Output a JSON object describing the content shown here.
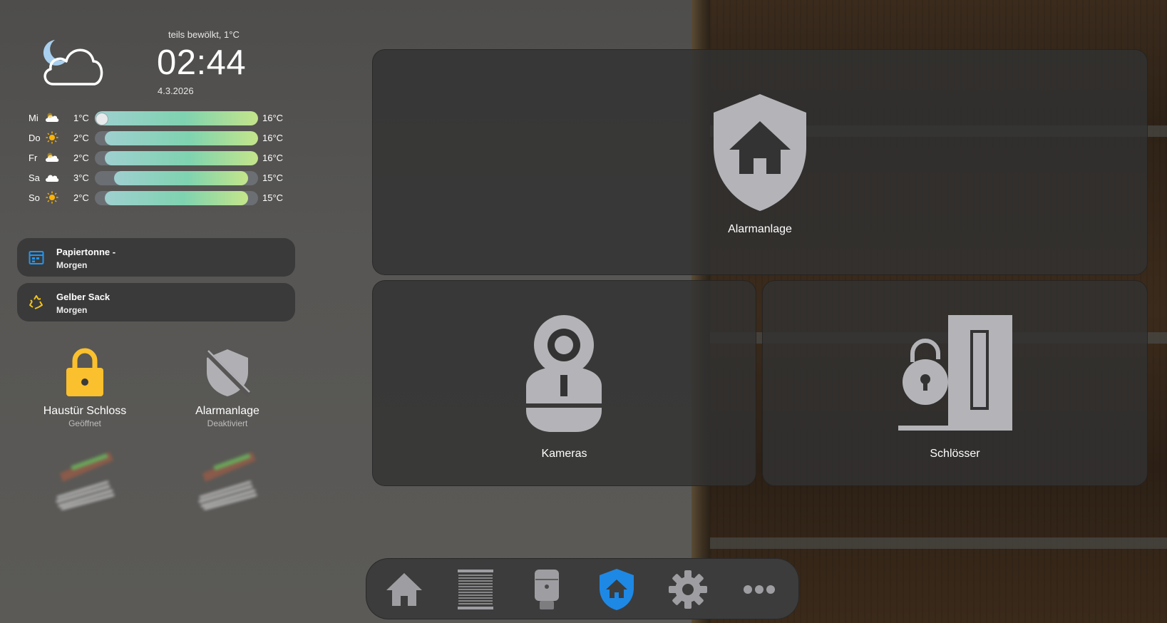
{
  "weather": {
    "condition": "teils bewölkt, 1°C",
    "time": "02:44",
    "date": "4.3.2026",
    "icon": "partly-cloudy-night-icon",
    "forecast": [
      {
        "day": "Mi",
        "icon": "cloud-icon",
        "low": "1°C",
        "high": "16°C",
        "range": [
          0.0,
          1.0
        ],
        "current": 0.0
      },
      {
        "day": "Do",
        "icon": "sun-icon",
        "low": "2°C",
        "high": "16°C",
        "range": [
          0.06,
          1.0
        ]
      },
      {
        "day": "Fr",
        "icon": "cloud-icon",
        "low": "2°C",
        "high": "16°C",
        "range": [
          0.06,
          1.0
        ]
      },
      {
        "day": "Sa",
        "icon": "cloud-icon",
        "low": "3°C",
        "high": "15°C",
        "range": [
          0.12,
          0.94
        ]
      },
      {
        "day": "So",
        "icon": "sun-icon",
        "low": "2°C",
        "high": "15°C",
        "range": [
          0.06,
          0.94
        ]
      }
    ]
  },
  "trash": [
    {
      "title": "Papiertonne -",
      "subtitle": "Morgen",
      "icon": "calendar-icon",
      "color": "#2196f3"
    },
    {
      "title": "Gelber Sack",
      "subtitle": "Morgen",
      "icon": "recycle-icon",
      "color": "#f5c518"
    }
  ],
  "status": [
    {
      "name": "Haustür Schloss",
      "state": "Geöffnet",
      "icon": "lock-open-icon",
      "color": "#fbc02d"
    },
    {
      "name": "Alarmanlage",
      "state": "Deaktiviert",
      "icon": "shield-off-icon",
      "color": "#b0b0b4"
    }
  ],
  "tiles": [
    {
      "label": "Alarmanlage",
      "icon": "shield-home-icon"
    },
    {
      "label": "Kameras",
      "icon": "webcam-icon"
    },
    {
      "label": "Schlösser",
      "icon": "door-lock-icon"
    }
  ],
  "nav": {
    "active": 3,
    "active_color": "#1e88e5",
    "items": [
      "home-icon",
      "blinds-icon",
      "thermostat-icon",
      "shield-home-icon",
      "gear-icon",
      "more-icon"
    ]
  }
}
